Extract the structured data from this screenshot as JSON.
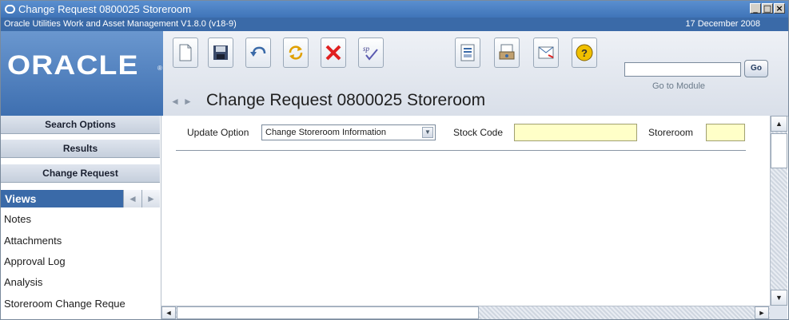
{
  "window": {
    "title": "Change Request 0800025 Storeroom",
    "controls": [
      "_",
      "□",
      "×"
    ]
  },
  "status": {
    "app_version": "Oracle Utilities Work and Asset Management V1.8.0 (v18-9)",
    "date": "17 December  2008"
  },
  "logo": {
    "text": "ORACLE",
    "trademark": "®"
  },
  "toolbar": {
    "icons": [
      "new-document-icon",
      "save-icon",
      "undo-icon",
      "refresh-icon",
      "delete-icon",
      "spellcheck-icon",
      "report-icon",
      "print-icon",
      "route-icon",
      "help-icon"
    ],
    "go_to_module_placeholder": "",
    "go_label": "Go",
    "go_to_module_label": "Go to Module"
  },
  "page": {
    "title": "Change Request 0800025 Storeroom",
    "nav_prev": "◄",
    "nav_next": "►"
  },
  "sidebar": {
    "search_options": "Search Options",
    "results": "Results",
    "change_request": "Change Request",
    "views_label": "Views",
    "views_prev": "◄",
    "views_next": "►",
    "views": [
      "Notes",
      "Attachments",
      "Approval Log",
      "Analysis",
      "Storeroom Change Reque"
    ]
  },
  "form": {
    "update_option_label": "Update Option",
    "update_option_value": "Change Storeroom Information",
    "stock_code_label": "Stock Code",
    "stock_code_value": "",
    "storeroom_label": "Storeroom",
    "storeroom_value": ""
  },
  "colors": {
    "title_bar": "#4a82c4",
    "status_bar": "#3a6aa8",
    "required_field": "#ffffc8"
  }
}
